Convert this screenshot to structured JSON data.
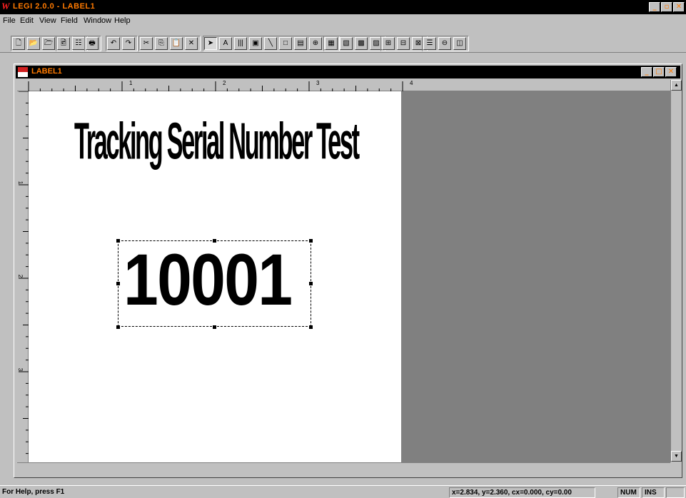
{
  "app": {
    "title": "LEGI 2.0.0 - LABEL1",
    "icon": "app-logo-icon",
    "window_controls": {
      "minimize": "_",
      "restore": "▫",
      "close": "✕"
    }
  },
  "menubar": {
    "items": [
      {
        "label": "File"
      },
      {
        "label": "Edit"
      },
      {
        "label": "View"
      },
      {
        "label": "Field"
      },
      {
        "label": "Window"
      },
      {
        "label": "Help"
      }
    ]
  },
  "toolbar": {
    "buttons": [
      {
        "name": "new-icon",
        "glyph": "🗋"
      },
      {
        "name": "open-icon",
        "glyph": "📂"
      },
      {
        "name": "open-template-icon",
        "glyph": "🗁"
      },
      {
        "name": "save-icon",
        "glyph": "💾"
      },
      {
        "name": "print-preview-icon",
        "glyph": "🖻"
      },
      {
        "name": "properties-icon",
        "glyph": "☷"
      },
      {
        "name": "print-icon",
        "glyph": "🖶"
      },
      {
        "name": "undo-icon",
        "glyph": "↶"
      },
      {
        "name": "redo-icon",
        "glyph": "↷"
      },
      {
        "name": "cut-icon",
        "glyph": "✂"
      },
      {
        "name": "copy-icon",
        "glyph": "⎘"
      },
      {
        "name": "paste-icon",
        "glyph": "📋"
      },
      {
        "name": "delete-icon",
        "glyph": "✕"
      },
      {
        "name": "pointer-icon",
        "glyph": "➤"
      },
      {
        "name": "text-tool-icon",
        "glyph": "A"
      },
      {
        "name": "barcode-tool-icon",
        "glyph": "|||"
      },
      {
        "name": "image-tool-icon",
        "glyph": "▣"
      },
      {
        "name": "line-tool-icon",
        "glyph": "╲"
      },
      {
        "name": "rectangle-tool-icon",
        "glyph": "□"
      },
      {
        "name": "field-box-tool-icon",
        "glyph": "▤"
      },
      {
        "name": "zoom-in-icon",
        "glyph": "⊕"
      },
      {
        "name": "zoom-out-icon",
        "glyph": "⊖"
      },
      {
        "name": "bring-forward-icon",
        "glyph": "▦"
      },
      {
        "name": "send-backward-icon",
        "glyph": "▧"
      },
      {
        "name": "bring-to-front-icon",
        "glyph": "▩"
      },
      {
        "name": "send-to-back-icon",
        "glyph": "▨"
      },
      {
        "name": "align-left-icon",
        "glyph": "⊞"
      },
      {
        "name": "align-center-icon",
        "glyph": "⊟"
      },
      {
        "name": "align-right-icon",
        "glyph": "⊠"
      },
      {
        "name": "align-top-icon",
        "glyph": "☰"
      },
      {
        "name": "align-middle-icon",
        "glyph": "⊖"
      },
      {
        "name": "align-bottom-icon",
        "glyph": "◫"
      }
    ]
  },
  "document": {
    "title": "LABEL1",
    "ruler_unit": "in",
    "ruler_h_labels": [
      "1",
      "2",
      "3",
      "4"
    ],
    "ruler_v_labels": [
      "1",
      "2",
      "3"
    ],
    "label_title": "Tracking Serial Number Test",
    "serial_number": "10001"
  },
  "statusbar": {
    "help": "For Help, press F1",
    "coords": "x=2.834, y=2.360, cx=0.000, cy=0.00",
    "num": "NUM",
    "ins": "INS"
  },
  "colors": {
    "title_bg": "#000000",
    "title_text": "#ff7a00",
    "chrome": "#c0c0c0",
    "workspace": "#808080"
  }
}
